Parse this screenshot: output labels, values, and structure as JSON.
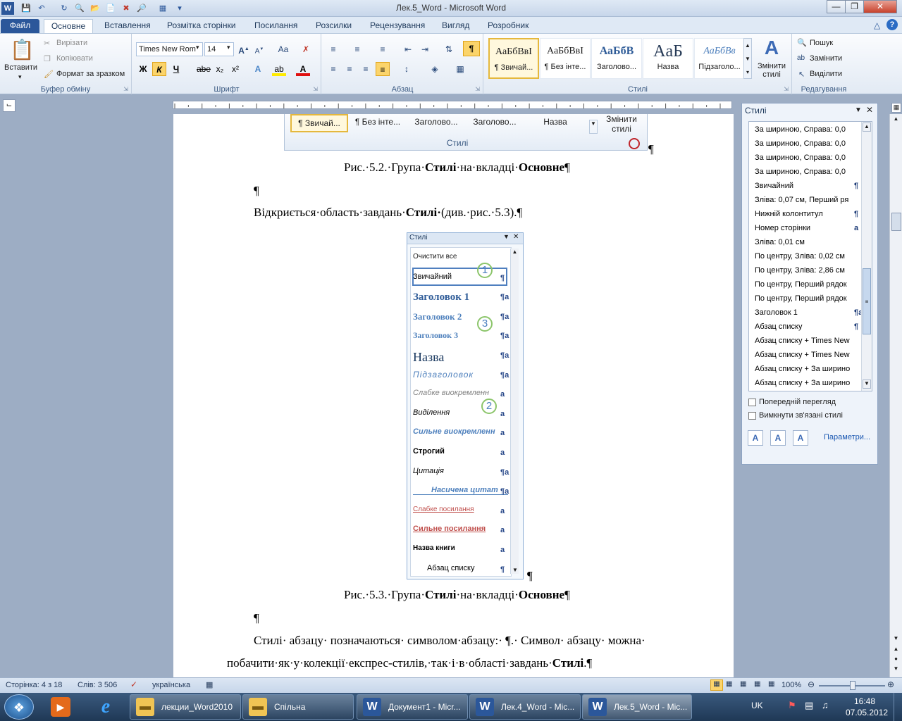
{
  "window": {
    "title": "Лек.5_Word  -  Microsoft Word"
  },
  "tabs": [
    "Файл",
    "Основне",
    "Вставлення",
    "Розмітка сторінки",
    "Посилання",
    "Розсилки",
    "Рецензування",
    "Вигляд",
    "Розробник"
  ],
  "clipboard": {
    "paste": "Вставити",
    "cut": "Вирізати",
    "copy": "Копіювати",
    "format": "Формат за зразком",
    "caption": "Буфер обміну"
  },
  "font": {
    "name": "Times New Rom",
    "size": "14",
    "caption": "Шрифт",
    "bold": "Ж",
    "italic": "К",
    "underline": "Ч",
    "strike": "abe",
    "sub": "x₂",
    "sup": "x²",
    "case": "Aa"
  },
  "paragraph": {
    "caption": "Абзац",
    "show_marks": "¶"
  },
  "styles": {
    "caption": "Стилі",
    "items": [
      {
        "preview": "АаБбВвІ",
        "label": "¶ Звичай..."
      },
      {
        "preview": "АаБбВвІ",
        "label": "¶ Без інте..."
      },
      {
        "preview": "АаБбВ",
        "label": "Заголово..."
      },
      {
        "preview": "AaБ",
        "label": "Назва"
      },
      {
        "preview": "АаБбВв",
        "label": "Підзаголо..."
      }
    ],
    "change": "Змінити стилі"
  },
  "editing": {
    "caption": "Редагування",
    "find": "Пошук",
    "replace": "Замінити",
    "select": "Виділити"
  },
  "doc": {
    "fig52": {
      "items": [
        "¶ Звичай...",
        "¶ Без інте...",
        "Заголово...",
        "Заголово...",
        "Назва"
      ],
      "change": "Змінити стилі",
      "caption": "Стилі",
      "pilcrow": "¶"
    },
    "cap52_pre": "Рис.·5.2.·Група·",
    "cap52_b1": "Стилі",
    "cap52_mid": "·на·вкладці·",
    "cap52_b2": "Основне",
    "cap52_end": "¶",
    "empty1": "¶",
    "open_pre": "Відкриється·область·завдань·",
    "open_b": "Стилі·",
    "open_post": "(див.·рис.·5.3).¶",
    "fig53": {
      "title": "Стилі",
      "items": [
        {
          "label": "Очистити все",
          "mark": ""
        },
        {
          "label": "Звичайний",
          "mark": "¶"
        },
        {
          "label": "Заголовок 1",
          "mark": "¶a"
        },
        {
          "label": "Заголовок 2",
          "mark": "¶a"
        },
        {
          "label": "Заголовок 3",
          "mark": "¶a"
        },
        {
          "label": "Назва",
          "mark": "¶a"
        },
        {
          "label": "Підзаголовок",
          "mark": "¶a"
        },
        {
          "label": "Слабке виокремленн",
          "mark": "a"
        },
        {
          "label": "Виділення",
          "mark": "a"
        },
        {
          "label": "Сильне виокремленн",
          "mark": "a"
        },
        {
          "label": "Строгий",
          "mark": "a"
        },
        {
          "label": "Цитація",
          "mark": "¶a"
        },
        {
          "label": "Насичена цитат",
          "mark": "¶a"
        },
        {
          "label": "Слабке посилання",
          "mark": "a"
        },
        {
          "label": "Сильне посилання",
          "mark": "a"
        },
        {
          "label": "Назва книги",
          "mark": "a"
        },
        {
          "label": "Абзац списку",
          "mark": "¶"
        }
      ],
      "callouts": [
        "1",
        "2",
        "3"
      ],
      "pilcrow": "¶"
    },
    "cap53_pre": "Рис.·5.3.·Група·",
    "cap53_b1": "Стилі",
    "cap53_mid": "·на·вкладці·",
    "cap53_b2": "Основне",
    "cap53_end": "¶",
    "empty2": "¶",
    "p1": "Стилі·  абзацу·  позначаються·  символом·абзацу:·  ¶.·  Символ·  абзацу·  можна·",
    "p2_pre": "побачити·як·у·колекції·експрес-стилів,·так·і·в·області·завдань·",
    "p2_b": "Стилі",
    "p2_end": ".¶"
  },
  "pane": {
    "title": "Стилі",
    "items": [
      {
        "label": "За шириною, Справа:  0,0",
        "mark": ""
      },
      {
        "label": "За шириною, Справа:  0,0",
        "mark": ""
      },
      {
        "label": "За шириною, Справа:  0,0",
        "mark": ""
      },
      {
        "label": "За шириною, Справа:  0,0",
        "mark": ""
      },
      {
        "label": "Звичайний",
        "mark": "¶"
      },
      {
        "label": "Зліва:  0,07 см, Перший ря",
        "mark": ""
      },
      {
        "label": "Нижній колонтитул",
        "mark": "¶"
      },
      {
        "label": "Номер сторінки",
        "mark": "a"
      },
      {
        "label": "Зліва:  0,01 см",
        "mark": ""
      },
      {
        "label": "По центру, Зліва:  0,02 см",
        "mark": ""
      },
      {
        "label": "По центру, Зліва:  2,86 см",
        "mark": ""
      },
      {
        "label": "По центру, Перший рядок",
        "mark": ""
      },
      {
        "label": "По центру, Перший рядок",
        "mark": ""
      },
      {
        "label": "Заголовок 1",
        "mark": "¶a"
      },
      {
        "label": "Абзац списку",
        "mark": "¶"
      },
      {
        "label": "Абзац списку + Times New",
        "mark": ""
      },
      {
        "label": "Абзац списку + Times New",
        "mark": ""
      },
      {
        "label": "Абзац списку + За ширино",
        "mark": ""
      },
      {
        "label": "Абзац списку + За ширино",
        "mark": ""
      }
    ],
    "preview": "Попередній перегляд",
    "disable_linked": "Вимкнути зв'язані стилі",
    "options": "Параметри..."
  },
  "status": {
    "page": "Сторінка: 4 з 18",
    "words": "Слів: 3 506",
    "lang": "українська",
    "zoom": "100%"
  },
  "taskbar": {
    "items": [
      "лекции_Word2010",
      "Спільна",
      "Документ1 - Micr...",
      "Лек.4_Word - Mic...",
      "Лек.5_Word - Mic..."
    ],
    "lang": "UK",
    "time": "16:48",
    "date": "07.05.2012"
  }
}
